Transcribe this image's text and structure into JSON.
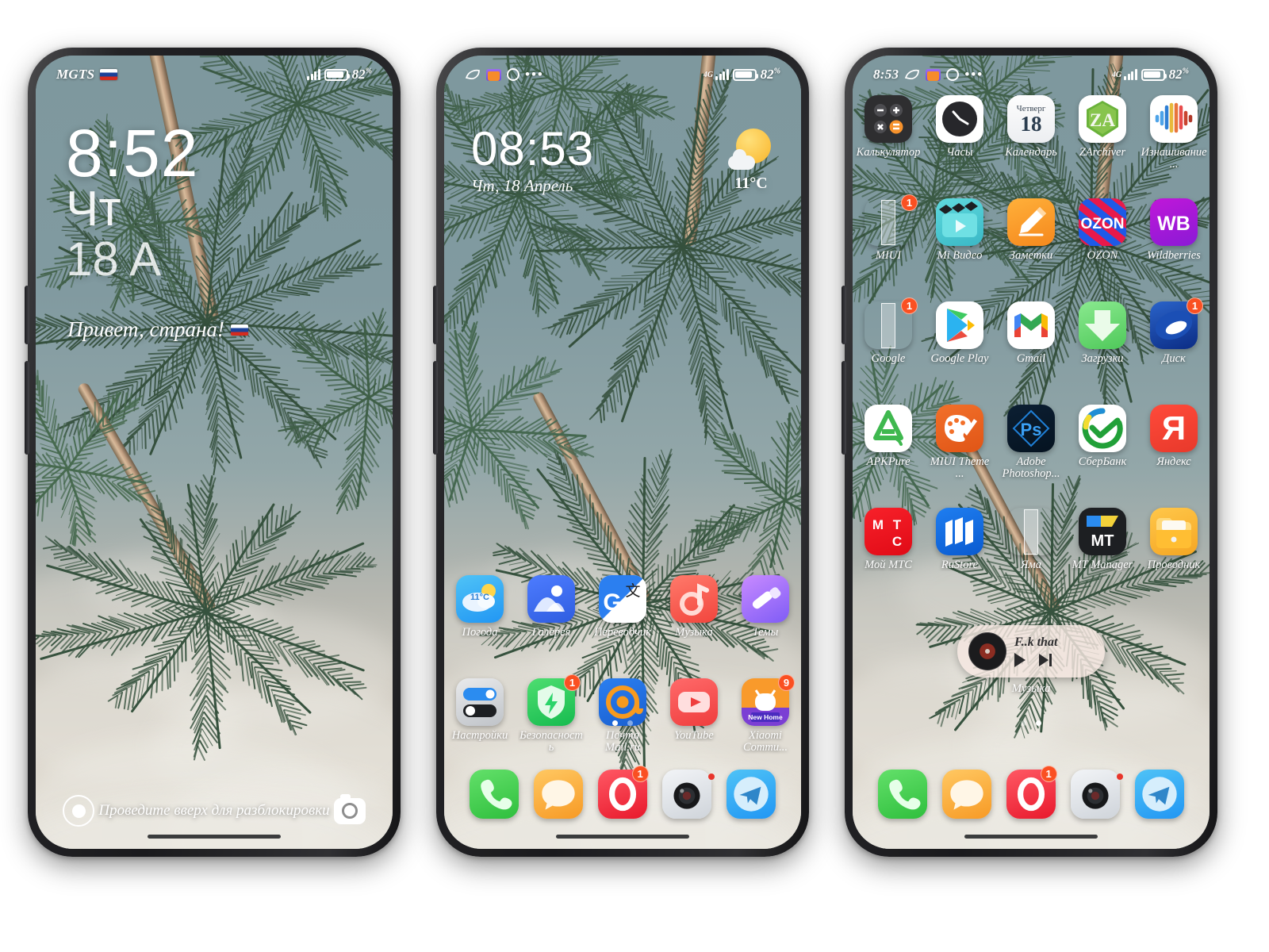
{
  "phone1": {
    "type": "lock-screen",
    "status": {
      "carrier": "MGTS",
      "flag": "ru-flag-icon",
      "battery_pct": "82",
      "battery_symbol": "%"
    },
    "clock": {
      "time": "8:52",
      "day_of_week": "Чт",
      "date": "18 A"
    },
    "greeting": "Привет, страна!",
    "bottom": {
      "hint": "Проведите вверх для разблокировки",
      "left_icon": "assistant-icon",
      "right_icon": "camera-icon"
    }
  },
  "phone2": {
    "type": "home-screen",
    "status": {
      "icons": [
        "leaf-icon",
        "mail-icon",
        "opera-icon",
        "more-dots-icon"
      ],
      "network": "4G",
      "battery_pct": "82",
      "battery_symbol": "%"
    },
    "clock": {
      "time": "08:53",
      "date": "Чт, 18 Апрель"
    },
    "weather": {
      "icon": "sun-cloud-icon",
      "temp": "11°C"
    },
    "rows": [
      [
        {
          "label": "Погода",
          "icon": "weather-app-icon",
          "badge": null
        },
        {
          "label": "Галерея",
          "icon": "gallery-icon",
          "badge": null
        },
        {
          "label": "Переводчик",
          "icon": "google-translate-icon",
          "badge": null
        },
        {
          "label": "Музыка",
          "icon": "music-icon",
          "badge": null
        },
        {
          "label": "Темы",
          "icon": "themes-icon",
          "badge": null
        }
      ],
      [
        {
          "label": "Настройки",
          "icon": "settings-icon",
          "badge": null
        },
        {
          "label": "Безопасность",
          "icon": "security-icon",
          "badge": "1"
        },
        {
          "label": "Почта Mail.ru",
          "icon": "mailru-icon",
          "badge": null
        },
        {
          "label": "YouTube",
          "icon": "youtube-icon",
          "badge": null
        },
        {
          "label": "Xiaomi Commu...",
          "icon": "xiaomi-community-icon",
          "badge": "9"
        }
      ]
    ],
    "page_dots": {
      "count": 2,
      "active": 0
    },
    "dock": [
      {
        "label": "Телефон",
        "icon": "phone-icon",
        "badge": null
      },
      {
        "label": "Сообщения",
        "icon": "messages-icon",
        "badge": null
      },
      {
        "label": "Opera",
        "icon": "opera-icon",
        "badge": "1"
      },
      {
        "label": "Камера",
        "icon": "camera-app-icon",
        "badge": "dot"
      },
      {
        "label": "Telegram",
        "icon": "telegram-icon",
        "badge": null
      }
    ]
  },
  "phone3": {
    "type": "home-screen",
    "status": {
      "time": "8:53",
      "icons": [
        "leaf-icon",
        "mail-icon",
        "opera-icon",
        "more-dots-icon"
      ],
      "network": "4G",
      "battery_pct": "82",
      "battery_symbol": "%"
    },
    "rows": [
      [
        {
          "label": "Калькулятор",
          "icon": "calculator-icon",
          "badge": null
        },
        {
          "label": "Часы",
          "icon": "clock-icon",
          "badge": null
        },
        {
          "label": "Календарь",
          "icon": "calendar-icon",
          "badge": null,
          "cal_dow": "Четверг",
          "cal_day": "18"
        },
        {
          "label": "ZArchiver",
          "icon": "zarchiver-icon",
          "badge": null
        },
        {
          "label": "Изнашивание ...",
          "icon": "wear-test-icon",
          "badge": null
        }
      ],
      [
        {
          "label": "MIUI",
          "icon": "miui-folder-icon",
          "badge": "1"
        },
        {
          "label": "Mi Видео",
          "icon": "mi-video-icon",
          "badge": null
        },
        {
          "label": "Заметки",
          "icon": "notes-icon",
          "badge": null
        },
        {
          "label": "OZON",
          "icon": "ozon-icon",
          "badge": null
        },
        {
          "label": "Wildberries",
          "icon": "wildberries-icon",
          "badge": null
        }
      ],
      [
        {
          "label": "Google",
          "icon": "google-folder-icon",
          "badge": "1"
        },
        {
          "label": "Google Play",
          "icon": "google-play-icon",
          "badge": null
        },
        {
          "label": "Gmail",
          "icon": "gmail-icon",
          "badge": null
        },
        {
          "label": "Загрузки",
          "icon": "downloads-icon",
          "badge": null
        },
        {
          "label": "Диск",
          "icon": "yandex-disk-icon",
          "badge": "1"
        }
      ],
      [
        {
          "label": "APKPure",
          "icon": "apkpure-icon",
          "badge": null
        },
        {
          "label": "MIUI Theme ...",
          "icon": "miui-theme-editor-icon",
          "badge": null
        },
        {
          "label": "Adobe Photoshop...",
          "icon": "photoshop-express-icon",
          "badge": null
        },
        {
          "label": "СберБанк",
          "icon": "sberbank-icon",
          "badge": null
        },
        {
          "label": "Яндекс",
          "icon": "yandex-icon",
          "badge": null
        }
      ],
      [
        {
          "label": "Мой МТС",
          "icon": "mts-icon",
          "badge": null
        },
        {
          "label": "RuStore",
          "icon": "rustore-icon",
          "badge": null
        },
        {
          "label": "Яма",
          "icon": "yama-folder-icon",
          "badge": null
        },
        {
          "label": "MT Manager",
          "icon": "mt-manager-icon",
          "badge": null
        },
        {
          "label": "Проводник",
          "icon": "file-explorer-icon",
          "badge": null
        }
      ]
    ],
    "music_widget": {
      "title": "F..k that",
      "label": "Музыка",
      "play_icon": "play-icon",
      "next_icon": "next-icon",
      "art": "vinyl-disc-icon"
    },
    "page_dots": {
      "count": 2,
      "active": 1
    },
    "dock": [
      {
        "label": "Телефон",
        "icon": "phone-icon",
        "badge": null
      },
      {
        "label": "Сообщения",
        "icon": "messages-icon",
        "badge": null
      },
      {
        "label": "Opera",
        "icon": "opera-icon",
        "badge": "1"
      },
      {
        "label": "Камера",
        "icon": "camera-app-icon",
        "badge": "dot"
      },
      {
        "label": "Telegram",
        "icon": "telegram-icon",
        "badge": null
      }
    ]
  },
  "colors": {
    "badge": "#FA5022",
    "sky": "#7E989E",
    "frond": "#3E5D46",
    "accent_blue": "#2B7FF0"
  }
}
